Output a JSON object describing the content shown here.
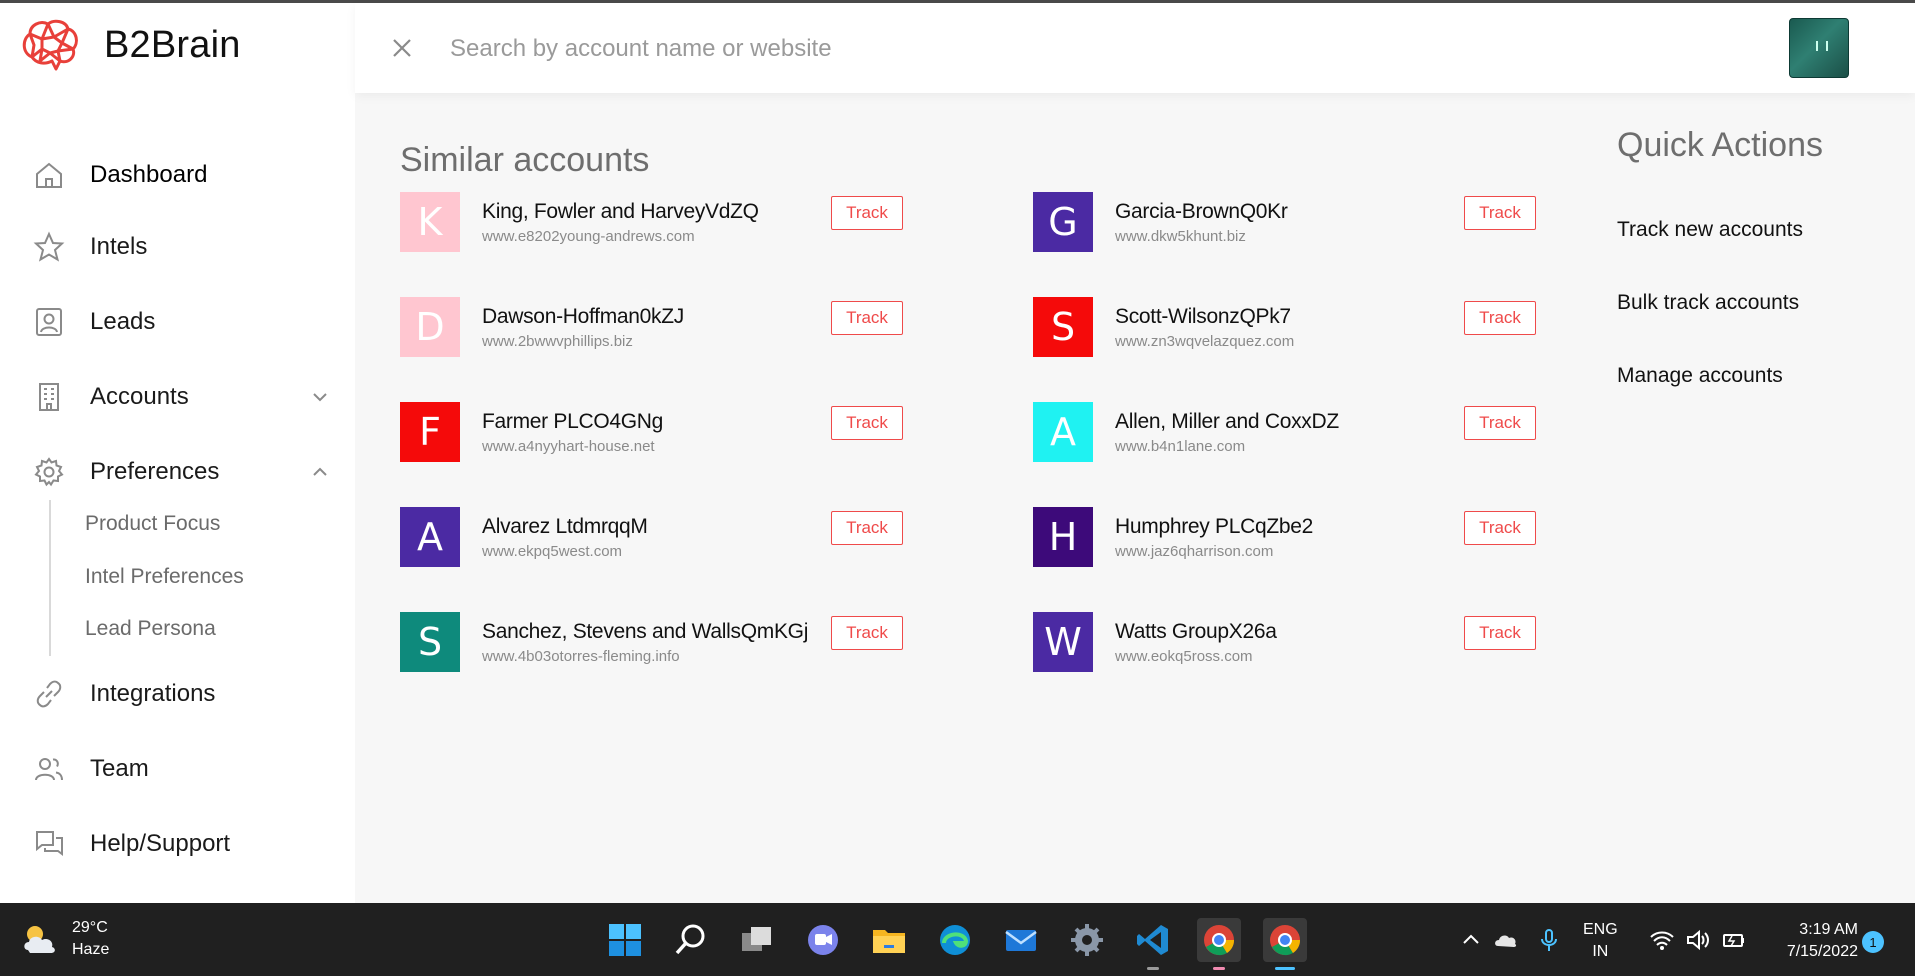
{
  "app": {
    "name": "B2Brain"
  },
  "sidebar": {
    "items": [
      {
        "label": "Dashboard",
        "icon": "home-icon"
      },
      {
        "label": "Intels",
        "icon": "star-icon"
      },
      {
        "label": "Leads",
        "icon": "contact-icon"
      },
      {
        "label": "Accounts",
        "icon": "building-icon"
      },
      {
        "label": "Preferences",
        "icon": "gear-icon"
      },
      {
        "label": "Integrations",
        "icon": "link-icon"
      },
      {
        "label": "Team",
        "icon": "team-icon"
      },
      {
        "label": "Help/Support",
        "icon": "chat-icon"
      }
    ],
    "sub_items": [
      "Product Focus",
      "Intel Preferences",
      "Lead Persona"
    ]
  },
  "search": {
    "placeholder": "Search by account name or website",
    "value": ""
  },
  "main": {
    "section_title": "Similar accounts",
    "track_label": "Track",
    "accounts": [
      {
        "letter": "K",
        "name": "King, Fowler and HarveyVdZQ",
        "site": "www.e8202young-andrews.com",
        "color": "#ffc6d0"
      },
      {
        "letter": "G",
        "name": "Garcia-BrownQ0Kr",
        "site": "www.dkw5khunt.biz",
        "color": "#4b2aa3"
      },
      {
        "letter": "D",
        "name": "Dawson-Hoffman0kZJ",
        "site": "www.2bwwvphillips.biz",
        "color": "#ffc6d0"
      },
      {
        "letter": "S",
        "name": "Scott-WilsonzQPk7",
        "site": "www.zn3wqvelazquez.com",
        "color": "#f50a0a"
      },
      {
        "letter": "F",
        "name": "Farmer PLCO4GNg",
        "site": "www.a4nyyhart-house.net",
        "color": "#f50a0a"
      },
      {
        "letter": "A",
        "name": "Allen, Miller and CoxxDZ",
        "site": "www.b4n1lane.com",
        "color": "#1ff2f2"
      },
      {
        "letter": "A",
        "name": "Alvarez LtdmrqqM",
        "site": "www.ekpq5west.com",
        "color": "#4b2aa3"
      },
      {
        "letter": "H",
        "name": "Humphrey PLCqZbe2",
        "site": "www.jaz6qharrison.com",
        "color": "#3d0a7a"
      },
      {
        "letter": "S",
        "name": "Sanchez, Stevens and WallsQmKGj",
        "site": "www.4b03otorres-fleming.info",
        "color": "#0e8a7c"
      },
      {
        "letter": "W",
        "name": "Watts GroupX26a",
        "site": "www.eokq5ross.com",
        "color": "#4b2aa3"
      }
    ]
  },
  "quick_actions": {
    "title": "Quick Actions",
    "items": [
      "Track new accounts",
      "Bulk track accounts",
      "Manage accounts"
    ]
  },
  "taskbar": {
    "weather": {
      "temp": "29°C",
      "condition": "Haze"
    },
    "apps": [
      "windows-start-icon",
      "search-icon",
      "task-view-icon",
      "teams-chat-icon",
      "file-explorer-icon",
      "edge-icon",
      "mail-icon",
      "settings-icon",
      "vscode-icon",
      "chrome-icon",
      "chrome-icon"
    ],
    "lang": {
      "line1": "ENG",
      "line2": "IN"
    },
    "time": "3:19 AM",
    "date": "7/15/2022",
    "notifications": "1"
  },
  "colors": {
    "accent": "#ef4a4a",
    "logo": "#e8403a",
    "taskbar": "#202020"
  }
}
